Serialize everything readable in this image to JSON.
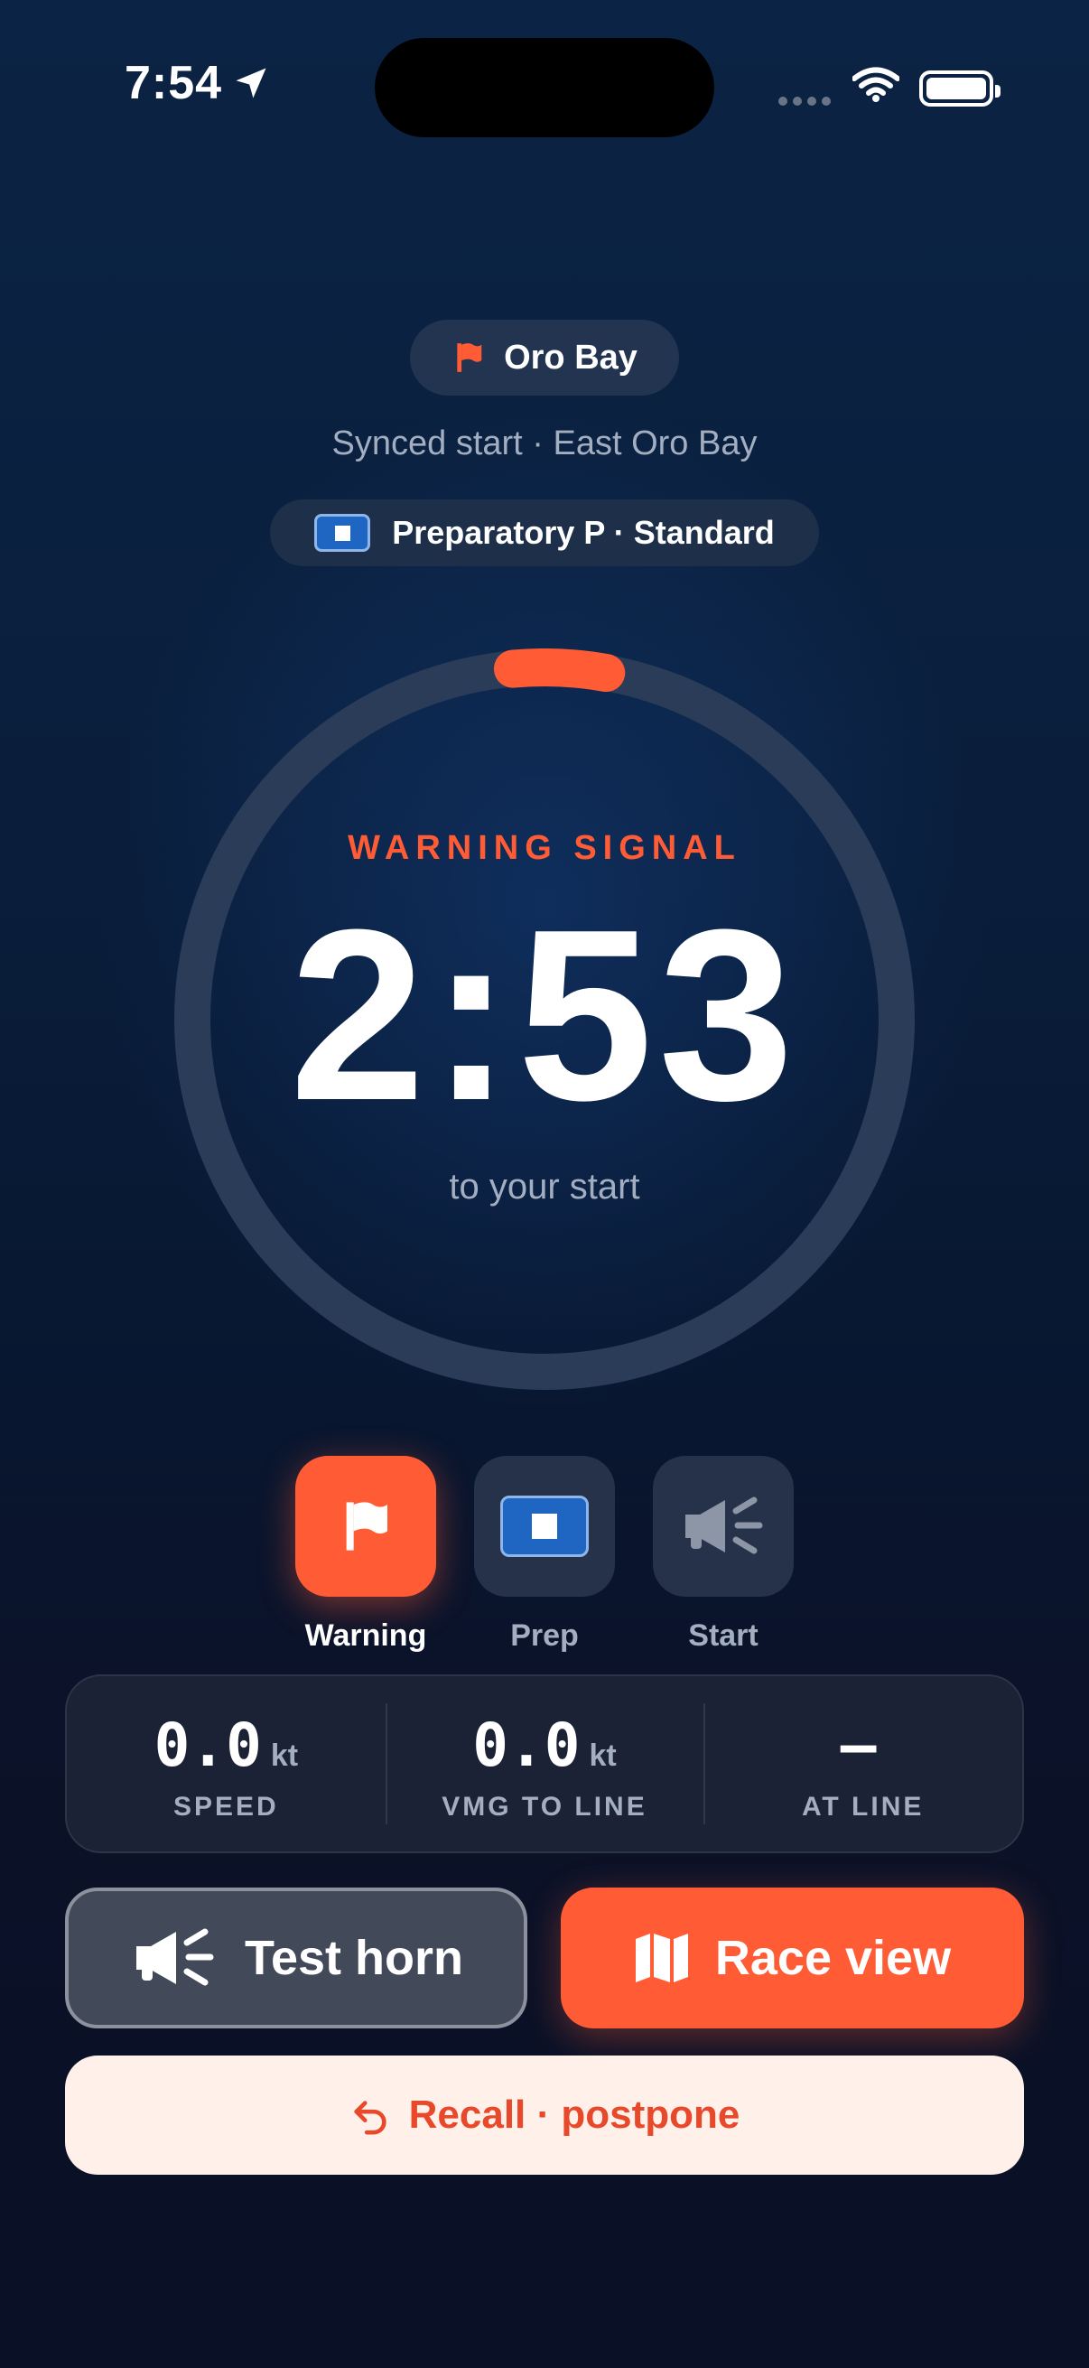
{
  "status_bar": {
    "time": "7:54"
  },
  "header": {
    "venue": "Oro Bay",
    "subtitle": "Synced start · East Oro Bay",
    "flag_pill": "Preparatory P · Standard"
  },
  "timer": {
    "phase": "WARNING SIGNAL",
    "countdown": "2:53",
    "caption": "to your start",
    "progress_fraction": 0.028
  },
  "steps": [
    {
      "label": "Warning",
      "icon": "flag-icon",
      "active": true
    },
    {
      "label": "Prep",
      "icon": "preparatory-flag-icon",
      "active": false
    },
    {
      "label": "Start",
      "icon": "horn-icon",
      "active": false
    }
  ],
  "stats": [
    {
      "value": "0.0",
      "unit": "kt",
      "label": "SPEED"
    },
    {
      "value": "0.0",
      "unit": "kt",
      "label": "VMG TO LINE"
    },
    {
      "value": "–",
      "unit": "",
      "label": "AT LINE"
    }
  ],
  "buttons": {
    "test_horn": "Test horn",
    "race_view": "Race view",
    "recall": "Recall · postpone"
  },
  "colors": {
    "accent": "#ff5c35",
    "p_flag_blue": "#1f66c2",
    "muted_text": "#a3aec0"
  }
}
